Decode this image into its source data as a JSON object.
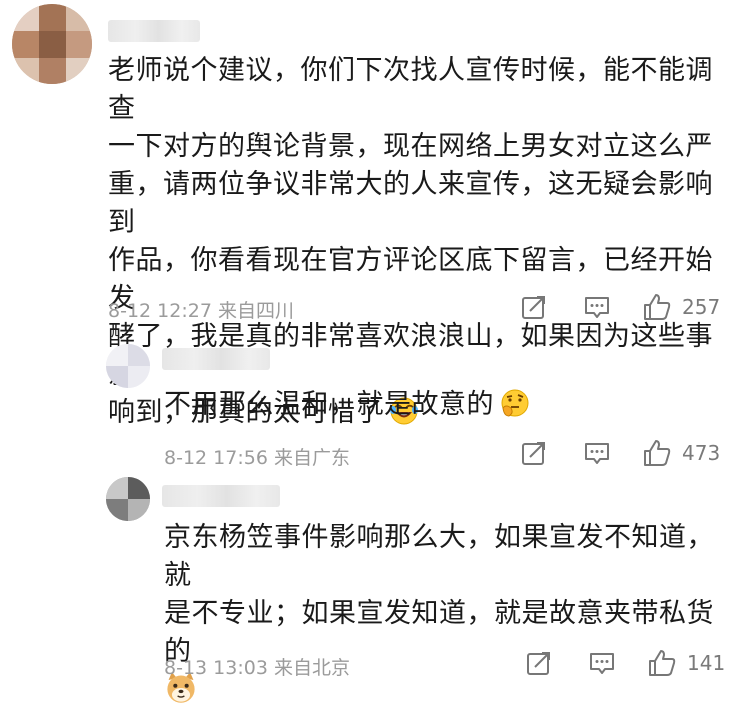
{
  "comments": [
    {
      "text": "老师说个建议，你们下次找人宣传时候，能不能调查\n一下对方的舆论背景，现在网络上男女对立这么严\n重，请两位争议非常大的人来宣传，这无疑会影响到\n作品，你看看现在官方评论区底下留言，已经开始发\n酵了，我是真的非常喜欢浪浪山，如果因为这些事影\n响到，那真的太可惜了",
      "emoji": "laugh-cry-emoji",
      "meta": "8-12 12:27  来自四川",
      "likes": "257"
    },
    {
      "text": "不用那么温和，就是故意的",
      "emoji": "thinking-emoji",
      "meta": "8-12 17:56  来自广东",
      "likes": "473"
    },
    {
      "text": "京东杨笠事件影响那么大，如果宣发不知道，就\n是不专业；如果宣发知道，就是故意夹带私货的",
      "emoji": "doge-emoji",
      "meta": "8-13 13:03  来自北京",
      "likes": "141"
    }
  ]
}
